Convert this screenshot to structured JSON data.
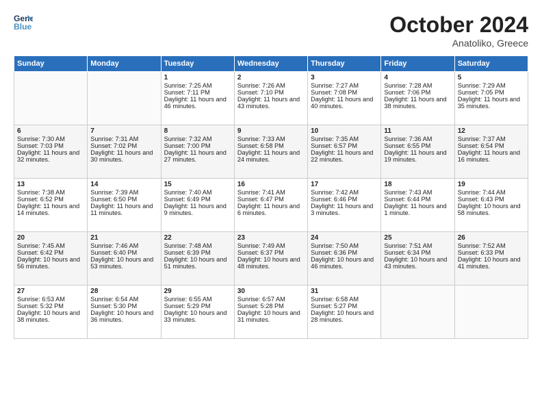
{
  "header": {
    "logo_line1": "General",
    "logo_line2": "Blue",
    "month": "October 2024",
    "location": "Anatoliko, Greece"
  },
  "days_of_week": [
    "Sunday",
    "Monday",
    "Tuesday",
    "Wednesday",
    "Thursday",
    "Friday",
    "Saturday"
  ],
  "weeks": [
    [
      {
        "day": "",
        "data": ""
      },
      {
        "day": "",
        "data": ""
      },
      {
        "day": "1",
        "sunrise": "Sunrise: 7:25 AM",
        "sunset": "Sunset: 7:11 PM",
        "daylight": "Daylight: 11 hours and 46 minutes."
      },
      {
        "day": "2",
        "sunrise": "Sunrise: 7:26 AM",
        "sunset": "Sunset: 7:10 PM",
        "daylight": "Daylight: 11 hours and 43 minutes."
      },
      {
        "day": "3",
        "sunrise": "Sunrise: 7:27 AM",
        "sunset": "Sunset: 7:08 PM",
        "daylight": "Daylight: 11 hours and 40 minutes."
      },
      {
        "day": "4",
        "sunrise": "Sunrise: 7:28 AM",
        "sunset": "Sunset: 7:06 PM",
        "daylight": "Daylight: 11 hours and 38 minutes."
      },
      {
        "day": "5",
        "sunrise": "Sunrise: 7:29 AM",
        "sunset": "Sunset: 7:05 PM",
        "daylight": "Daylight: 11 hours and 35 minutes."
      }
    ],
    [
      {
        "day": "6",
        "sunrise": "Sunrise: 7:30 AM",
        "sunset": "Sunset: 7:03 PM",
        "daylight": "Daylight: 11 hours and 32 minutes."
      },
      {
        "day": "7",
        "sunrise": "Sunrise: 7:31 AM",
        "sunset": "Sunset: 7:02 PM",
        "daylight": "Daylight: 11 hours and 30 minutes."
      },
      {
        "day": "8",
        "sunrise": "Sunrise: 7:32 AM",
        "sunset": "Sunset: 7:00 PM",
        "daylight": "Daylight: 11 hours and 27 minutes."
      },
      {
        "day": "9",
        "sunrise": "Sunrise: 7:33 AM",
        "sunset": "Sunset: 6:58 PM",
        "daylight": "Daylight: 11 hours and 24 minutes."
      },
      {
        "day": "10",
        "sunrise": "Sunrise: 7:35 AM",
        "sunset": "Sunset: 6:57 PM",
        "daylight": "Daylight: 11 hours and 22 minutes."
      },
      {
        "day": "11",
        "sunrise": "Sunrise: 7:36 AM",
        "sunset": "Sunset: 6:55 PM",
        "daylight": "Daylight: 11 hours and 19 minutes."
      },
      {
        "day": "12",
        "sunrise": "Sunrise: 7:37 AM",
        "sunset": "Sunset: 6:54 PM",
        "daylight": "Daylight: 11 hours and 16 minutes."
      }
    ],
    [
      {
        "day": "13",
        "sunrise": "Sunrise: 7:38 AM",
        "sunset": "Sunset: 6:52 PM",
        "daylight": "Daylight: 11 hours and 14 minutes."
      },
      {
        "day": "14",
        "sunrise": "Sunrise: 7:39 AM",
        "sunset": "Sunset: 6:50 PM",
        "daylight": "Daylight: 11 hours and 11 minutes."
      },
      {
        "day": "15",
        "sunrise": "Sunrise: 7:40 AM",
        "sunset": "Sunset: 6:49 PM",
        "daylight": "Daylight: 11 hours and 9 minutes."
      },
      {
        "day": "16",
        "sunrise": "Sunrise: 7:41 AM",
        "sunset": "Sunset: 6:47 PM",
        "daylight": "Daylight: 11 hours and 6 minutes."
      },
      {
        "day": "17",
        "sunrise": "Sunrise: 7:42 AM",
        "sunset": "Sunset: 6:46 PM",
        "daylight": "Daylight: 11 hours and 3 minutes."
      },
      {
        "day": "18",
        "sunrise": "Sunrise: 7:43 AM",
        "sunset": "Sunset: 6:44 PM",
        "daylight": "Daylight: 11 hours and 1 minute."
      },
      {
        "day": "19",
        "sunrise": "Sunrise: 7:44 AM",
        "sunset": "Sunset: 6:43 PM",
        "daylight": "Daylight: 10 hours and 58 minutes."
      }
    ],
    [
      {
        "day": "20",
        "sunrise": "Sunrise: 7:45 AM",
        "sunset": "Sunset: 6:42 PM",
        "daylight": "Daylight: 10 hours and 56 minutes."
      },
      {
        "day": "21",
        "sunrise": "Sunrise: 7:46 AM",
        "sunset": "Sunset: 6:40 PM",
        "daylight": "Daylight: 10 hours and 53 minutes."
      },
      {
        "day": "22",
        "sunrise": "Sunrise: 7:48 AM",
        "sunset": "Sunset: 6:39 PM",
        "daylight": "Daylight: 10 hours and 51 minutes."
      },
      {
        "day": "23",
        "sunrise": "Sunrise: 7:49 AM",
        "sunset": "Sunset: 6:37 PM",
        "daylight": "Daylight: 10 hours and 48 minutes."
      },
      {
        "day": "24",
        "sunrise": "Sunrise: 7:50 AM",
        "sunset": "Sunset: 6:36 PM",
        "daylight": "Daylight: 10 hours and 46 minutes."
      },
      {
        "day": "25",
        "sunrise": "Sunrise: 7:51 AM",
        "sunset": "Sunset: 6:34 PM",
        "daylight": "Daylight: 10 hours and 43 minutes."
      },
      {
        "day": "26",
        "sunrise": "Sunrise: 7:52 AM",
        "sunset": "Sunset: 6:33 PM",
        "daylight": "Daylight: 10 hours and 41 minutes."
      }
    ],
    [
      {
        "day": "27",
        "sunrise": "Sunrise: 6:53 AM",
        "sunset": "Sunset: 5:32 PM",
        "daylight": "Daylight: 10 hours and 38 minutes."
      },
      {
        "day": "28",
        "sunrise": "Sunrise: 6:54 AM",
        "sunset": "Sunset: 5:30 PM",
        "daylight": "Daylight: 10 hours and 36 minutes."
      },
      {
        "day": "29",
        "sunrise": "Sunrise: 6:55 AM",
        "sunset": "Sunset: 5:29 PM",
        "daylight": "Daylight: 10 hours and 33 minutes."
      },
      {
        "day": "30",
        "sunrise": "Sunrise: 6:57 AM",
        "sunset": "Sunset: 5:28 PM",
        "daylight": "Daylight: 10 hours and 31 minutes."
      },
      {
        "day": "31",
        "sunrise": "Sunrise: 6:58 AM",
        "sunset": "Sunset: 5:27 PM",
        "daylight": "Daylight: 10 hours and 28 minutes."
      },
      {
        "day": "",
        "data": ""
      },
      {
        "day": "",
        "data": ""
      }
    ]
  ]
}
